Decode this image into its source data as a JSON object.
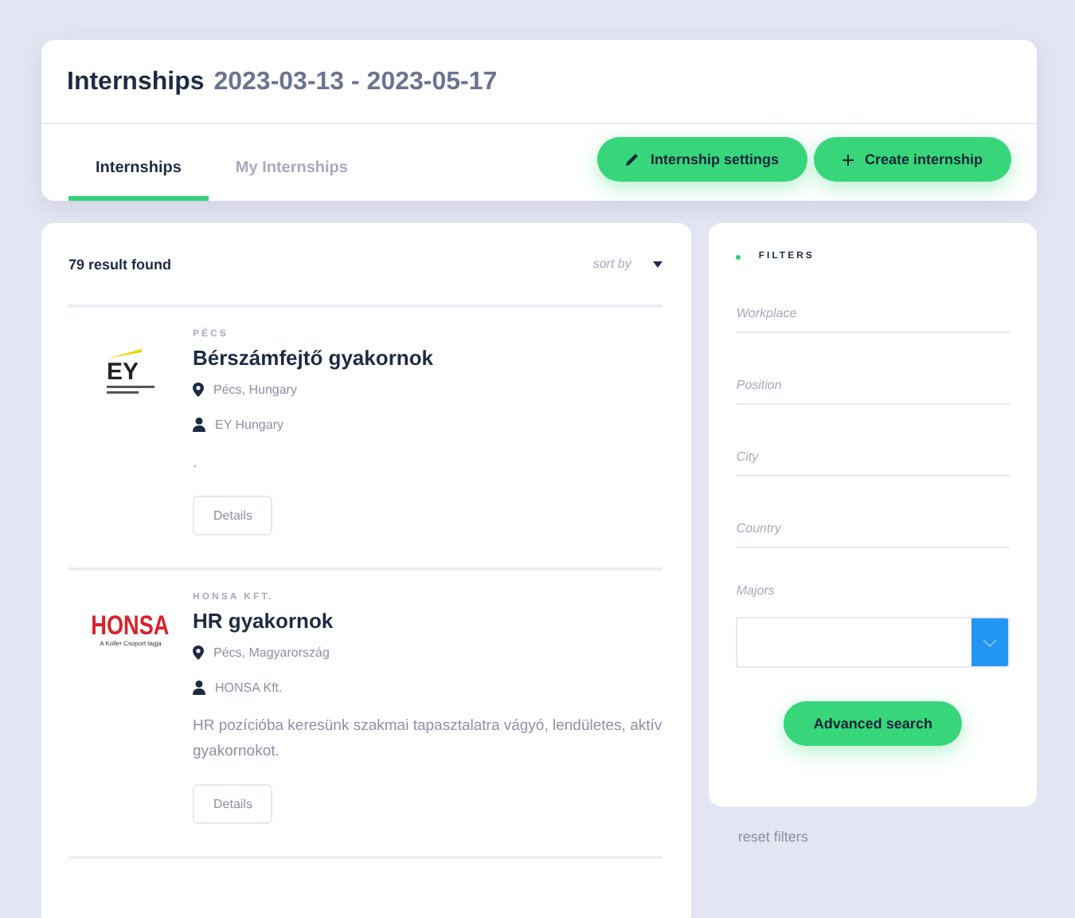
{
  "header": {
    "title": "Internships",
    "date_range": "2023-03-13 - 2023-05-17"
  },
  "tabs": [
    {
      "label": "Internships",
      "selected": true
    },
    {
      "label": "My Internships",
      "selected": false
    }
  ],
  "actions": [
    {
      "label": "Internship settings",
      "kind": "edit"
    },
    {
      "label": "Create internship",
      "kind": "add"
    }
  ],
  "results": {
    "count": "79 result found",
    "sort_label": "sort by"
  },
  "listings": [
    {
      "logo": {
        "kind": "ey",
        "text": "EY"
      },
      "tag": "PÉCS",
      "title": "Bérszámfejtő gyakornok",
      "location": "Pécs, Hungary",
      "company": "EY Hungary",
      "description": ".",
      "button": "Details"
    },
    {
      "logo": {
        "kind": "honsa",
        "text": "HONSA",
        "tagline": "A Koller Csoport tagja"
      },
      "tag": "HONSA KFT.",
      "title": "HR gyakornok",
      "location": "Pécs, Magyarország",
      "company": "HONSA Kft.",
      "description": "HR pozícióba keresünk szakmai tapasztalatra vágyó, lendületes, aktív gyakornokot.",
      "button": "Details"
    }
  ],
  "filters": {
    "heading": "FILTERS",
    "fields": [
      {
        "placeholder": "Workplace"
      },
      {
        "placeholder": "Position"
      },
      {
        "placeholder": "City"
      },
      {
        "placeholder": "Country"
      }
    ],
    "majors_label": "Majors",
    "search_button": "Advanced search",
    "reset": "reset filters"
  }
}
